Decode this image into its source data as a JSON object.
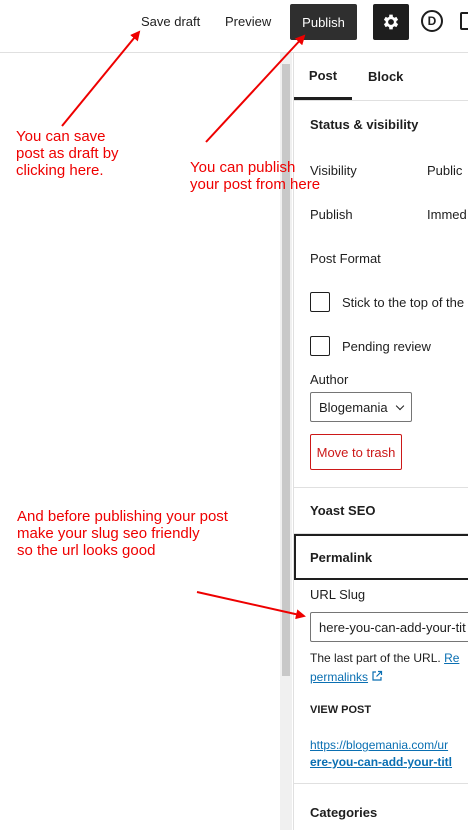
{
  "topbar": {
    "save_draft": "Save draft",
    "preview": "Preview",
    "publish": "Publish",
    "divi_letter": "D"
  },
  "sidebar": {
    "tabs": [
      "Post",
      "Block"
    ],
    "status_visibility": {
      "title": "Status & visibility",
      "visibility_label": "Visibility",
      "visibility_value": "Public",
      "publish_label": "Publish",
      "publish_value": "Immed",
      "post_format": "Post Format",
      "sticky_label": "Stick to the top of the",
      "pending_label": "Pending review",
      "author_label": "Author",
      "author_value": "Blogemania",
      "move_to_trash": "Move to trash"
    },
    "yoast": {
      "title": "Yoast SEO"
    },
    "permalink": {
      "title": "Permalink",
      "slug_label": "URL Slug",
      "slug_value": "here-you-can-add-your-tit",
      "help_text": "The last part of the URL.",
      "help_link": "Re",
      "help_link2": "permalinks",
      "view_post": "VIEW POST",
      "url_line1": "https://blogemania.com/ur",
      "url_line2": "ere-you-can-add-your-titl"
    },
    "categories": {
      "title": "Categories"
    }
  },
  "annotations": {
    "save_note": "You can save\npost as draft by\nclicking here.",
    "publish_note": "You can publish\nyour post from here",
    "slug_note": "And before publishing your post\nmake your slug seo friendly\nso the url looks good"
  },
  "colors": {
    "annotation": "#ee0000",
    "publish_bg": "#2f2f2f",
    "trash": "#cc1818",
    "link": "#0a6fb2"
  }
}
